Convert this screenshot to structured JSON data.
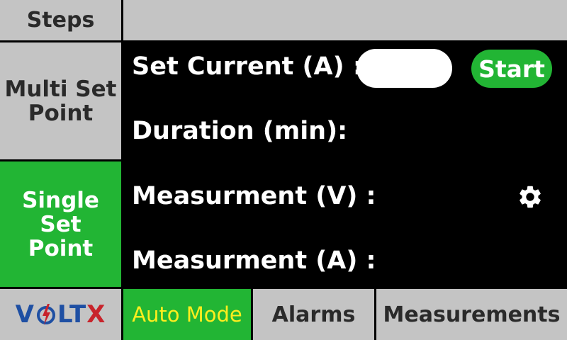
{
  "sidebar": {
    "header": "Steps",
    "items": [
      {
        "label_line1": "Multi Set",
        "label_line2": "Point",
        "active": false
      },
      {
        "label_line1": "Single Set",
        "label_line2": "Point",
        "active": true
      }
    ]
  },
  "main": {
    "set_current_label": "Set Current (A) :",
    "set_current_value": "",
    "start_label": "Start",
    "duration_label": "Duration (min):",
    "measurement_v_label": "Measurment (V) :",
    "measurement_a_label": "Measurment (A) :",
    "settings_icon": "gear-icon"
  },
  "logo": {
    "text_left": "V",
    "text_mid": "LT",
    "text_right": "X"
  },
  "bottom_tabs": [
    {
      "label": "Auto Mode",
      "active": true
    },
    {
      "label": "Alarms",
      "active": false
    },
    {
      "label": "Measurements",
      "active": false
    }
  ],
  "colors": {
    "accent_green": "#22b534",
    "panel_gray": "#c4c4c4",
    "auto_mode_text": "#ffee1e",
    "logo_blue": "#1e4fa3",
    "logo_red": "#c8232b"
  }
}
